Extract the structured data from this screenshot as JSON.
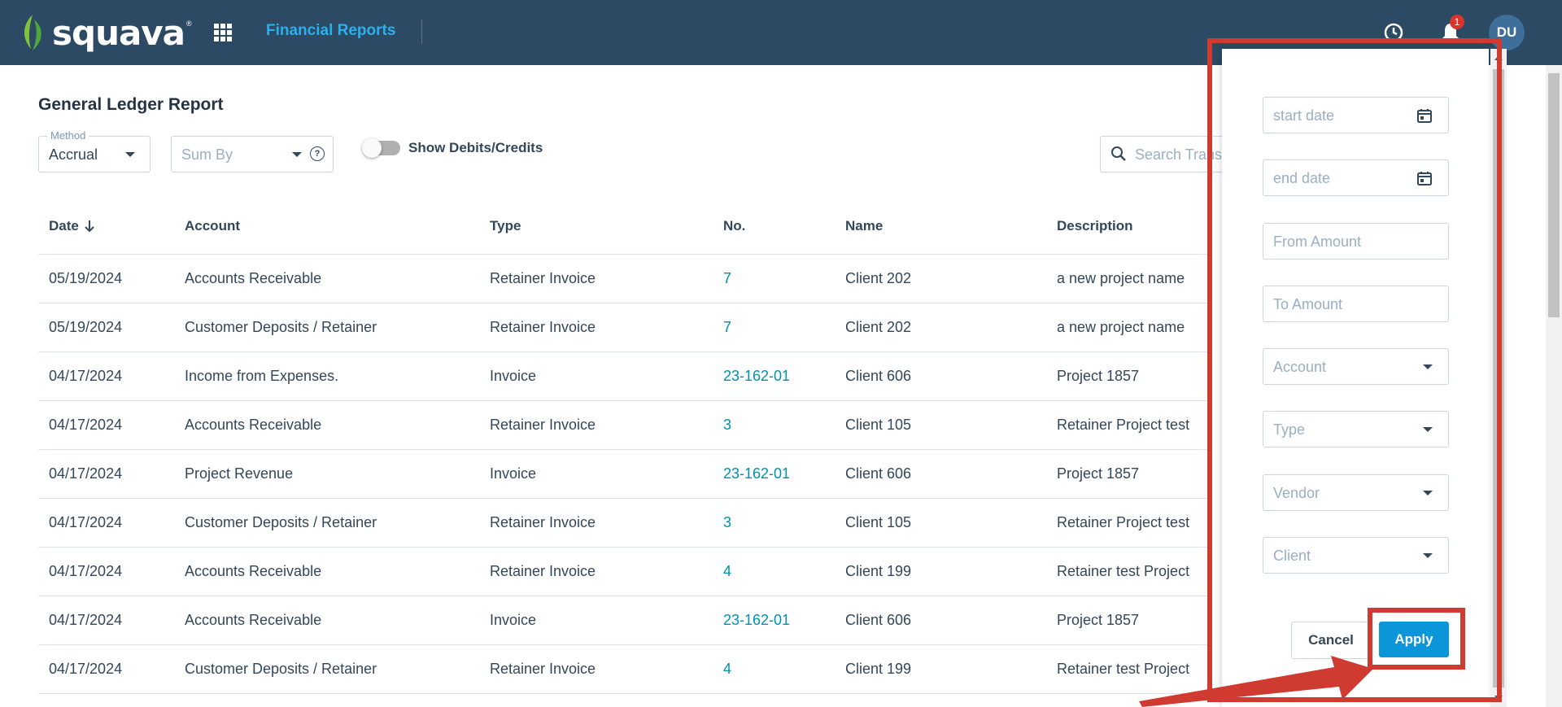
{
  "app": {
    "brand": "squava",
    "brand_mark": "®",
    "nav_title": "Financial Reports",
    "notification_count": "1",
    "avatar_initials": "DU"
  },
  "report": {
    "title": "General Ledger Report",
    "method": {
      "label": "Method",
      "value": "Accrual"
    },
    "sum_by": {
      "placeholder": "Sum By",
      "help": "?"
    },
    "toggle_label": "Show Debits/Credits",
    "search_placeholder": "Search Transactions"
  },
  "table": {
    "columns": [
      "Date",
      "Account",
      "Type",
      "No.",
      "Name",
      "Description"
    ],
    "rows": [
      [
        "05/19/2024",
        "Accounts Receivable",
        "Retainer Invoice",
        "7",
        "Client 202",
        "a new project name"
      ],
      [
        "05/19/2024",
        "Customer Deposits / Retainer",
        "Retainer Invoice",
        "7",
        "Client 202",
        "a new project name"
      ],
      [
        "04/17/2024",
        "Income from Expenses.",
        "Invoice",
        "23-162-01",
        "Client 606",
        "Project 1857"
      ],
      [
        "04/17/2024",
        "Accounts Receivable",
        "Retainer Invoice",
        "3",
        "Client 105",
        "Retainer Project test"
      ],
      [
        "04/17/2024",
        "Project Revenue",
        "Invoice",
        "23-162-01",
        "Client 606",
        "Project 1857"
      ],
      [
        "04/17/2024",
        "Customer Deposits / Retainer",
        "Retainer Invoice",
        "3",
        "Client 105",
        "Retainer Project test"
      ],
      [
        "04/17/2024",
        "Accounts Receivable",
        "Retainer Invoice",
        "4",
        "Client 199",
        "Retainer test Project"
      ],
      [
        "04/17/2024",
        "Accounts Receivable",
        "Invoice",
        "23-162-01",
        "Client 606",
        "Project 1857"
      ],
      [
        "04/17/2024",
        "Customer Deposits / Retainer",
        "Retainer Invoice",
        "4",
        "Client 199",
        "Retainer test Project"
      ]
    ]
  },
  "filter_panel": {
    "start_date": "start date",
    "end_date": "end date",
    "from_amount": "From Amount",
    "to_amount": "To Amount",
    "account": "Account",
    "type": "Type",
    "vendor": "Vendor",
    "client": "Client",
    "cancel": "Cancel",
    "apply": "Apply"
  },
  "colors": {
    "topbar": "#2c4a63",
    "accent": "#2ab0ec",
    "link": "#0091ae",
    "apply": "#0b96d9",
    "annotation": "#cf3b31"
  }
}
